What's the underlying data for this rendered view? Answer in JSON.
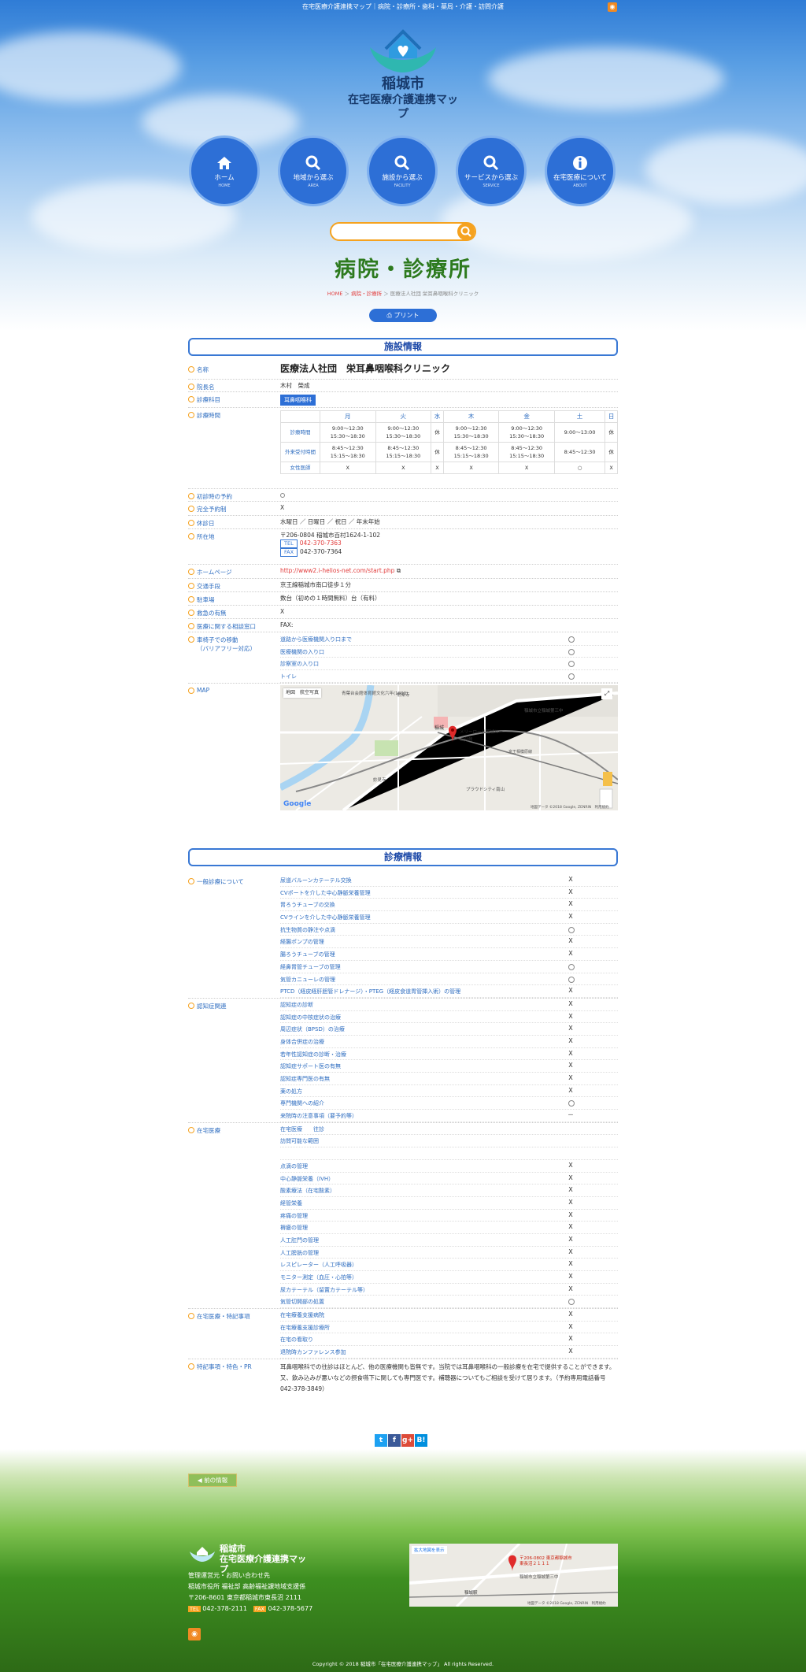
{
  "topbar": {
    "text": "在宅医療介護連携マップ｜病院・診療所・歯科・薬局・介護・訪問介護"
  },
  "logo": {
    "city": "稲城市",
    "sub": "在宅医療介護連携マップ"
  },
  "nav": [
    {
      "label": "ホーム",
      "en": "HOME",
      "icon": "home-icon"
    },
    {
      "label": "地域から選ぶ",
      "en": "AREA",
      "icon": "search-icon"
    },
    {
      "label": "施設から選ぶ",
      "en": "FACILITY",
      "icon": "search-icon"
    },
    {
      "label": "サービスから選ぶ",
      "en": "SERVICE",
      "icon": "search-icon"
    },
    {
      "label": "在宅医療について",
      "en": "ABOUT",
      "icon": "info-icon"
    }
  ],
  "page": {
    "title": "病院・診療所"
  },
  "breadcrumb": {
    "home": "HOME",
    "cat": "病院・診療所",
    "current": "医療法人社団 栄耳鼻咽喉科クリニック"
  },
  "print_label": "プリント",
  "facility": {
    "heading": "施設情報",
    "name_label": "名称",
    "name": "医療法人社団　栄耳鼻咽喉科クリニック",
    "director_label": "院長名",
    "director": "木村　榮成",
    "dept_label": "診療科目",
    "dept": "耳鼻咽喉科",
    "hours_label": "診療時間",
    "schedule": {
      "days": [
        "月",
        "火",
        "水",
        "木",
        "金",
        "土",
        "日"
      ],
      "rows": [
        {
          "label": "診療時間",
          "cells": [
            "9:00〜12:30\n15:30〜18:30",
            "9:00〜12:30\n15:30〜18:30",
            "休",
            "9:00〜12:30\n15:30〜18:30",
            "9:00〜12:30\n15:30〜18:30",
            "9:00〜13:00",
            "休"
          ]
        },
        {
          "label": "外来受付時間",
          "cells": [
            "8:45〜12:30\n15:15〜18:30",
            "8:45〜12:30\n15:15〜18:30",
            "休",
            "8:45〜12:30\n15:15〜18:30",
            "8:45〜12:30\n15:15〜18:30",
            "8:45〜12:30",
            "休"
          ]
        },
        {
          "label": "女性医師",
          "cells": [
            "X",
            "X",
            "X",
            "X",
            "X",
            "○",
            "X"
          ]
        }
      ]
    },
    "first_reserve_label": "初診時の予約",
    "full_reserve_label": "完全予約制",
    "full_reserve": "X",
    "holiday_label": "休診日",
    "holiday": "水曜日 ／ 日曜日 ／ 祝日 ／ 年末年始",
    "address_label": "所在地",
    "address": "〒206-0804 稲城市百村1624-1-102",
    "tel_tag": "TEL",
    "tel": "042-370-7363",
    "fax_tag": "FAX",
    "fax": "042-370-7364",
    "homepage_label": "ホームページ",
    "homepage": "http://www2.i-helios-net.com/start.php",
    "access_label": "交通手段",
    "access": "京王線稲城市南口徒歩１分",
    "parking_label": "駐車場",
    "parking": "数台（初めの１時間無料）台（有料）",
    "emergency_label": "救急の有無",
    "emergency": "X",
    "consult_label": "医療に関する相談窓口",
    "consult": "FAX:",
    "barrier_label": "車椅子での移動",
    "barrier_label2": "（バリアフリー対応）",
    "barrier": [
      "道路から医療機関入り口まで",
      "医療機関の入り口",
      "診察室の入り口",
      "トイレ"
    ],
    "map_label": "MAP",
    "map": {
      "tab1": "地図",
      "tab2": "航空写真",
      "station": "稲城",
      "clinic": "メリーロード稲城ルーム分館",
      "google": "Google",
      "terms": "地図データ ©2018 Google, ZENRIN　利用規約",
      "park": "青葉台会館体育館文化六年(1800)",
      "shrine": "妙見寺",
      "store": "プラウドシティ南山",
      "temple": "常楽寺",
      "cityhall": "稲城市立稲城第三中",
      "line": "京王相模原線"
    }
  },
  "medical": {
    "heading": "診療情報",
    "groups": [
      {
        "label": "一般診療について",
        "items": [
          [
            "尿道バルーンカテーテル交換",
            "X"
          ],
          [
            "CVポートを介した中心静脈栄養管理",
            "X"
          ],
          [
            "胃ろうチューブの交換",
            "X"
          ],
          [
            "CVラインを介した中心静脈栄養管理",
            "X"
          ],
          [
            "抗生物質の静注や点滴",
            "○"
          ],
          [
            "経腸ポンプの管理",
            "X"
          ],
          [
            "腸ろうチューブの管理",
            "X"
          ],
          [
            "経鼻胃管チューブの管理",
            "○"
          ],
          [
            "気管カニューレの管理",
            "○"
          ],
          [
            "PTCD（経皮経肝胆管ドレナージ）・PTEG（経皮食道胃管挿入術）の管理",
            "X"
          ]
        ]
      },
      {
        "label": "認知症関連",
        "items": [
          [
            "認知症の診断",
            "X"
          ],
          [
            "認知症の中核症状の治療",
            "X"
          ],
          [
            "周辺症状（BPSD）の治療",
            "X"
          ],
          [
            "身体合併症の治療",
            "X"
          ],
          [
            "若年性認知症の診断・治療",
            "X"
          ],
          [
            "認知症サポート医の有無",
            "X"
          ],
          [
            "認知症専門医の有無",
            "X"
          ],
          [
            "薬の処方",
            "X"
          ],
          [
            "専門機関への紹介",
            "○"
          ],
          [
            "来院時の注意事項（要予約等）",
            "－"
          ]
        ]
      },
      {
        "label": "在宅医療",
        "items": [
          [
            "在宅医療　　往診",
            ""
          ],
          [
            "訪問可能な範囲",
            ""
          ],
          [
            "",
            ""
          ],
          [
            "点滴の管理",
            "X"
          ],
          [
            "中心静脈栄養（IVH）",
            "X"
          ],
          [
            "酸素療法（在宅酸素）",
            "X"
          ],
          [
            "経管栄養",
            "X"
          ],
          [
            "疼痛の管理",
            "X"
          ],
          [
            "褥瘡の管理",
            "X"
          ],
          [
            "人工肛門の管理",
            "X"
          ],
          [
            "人工膀胱の管理",
            "X"
          ],
          [
            "レスピレーター（人工呼吸器）",
            "X"
          ],
          [
            "モニター測定（血圧・心拍等）",
            "X"
          ],
          [
            "尿カテーテル（留置カテーテル等）",
            "X"
          ],
          [
            "気管切開部の処置",
            "○"
          ]
        ]
      },
      {
        "label": "在宅医療・特記事項",
        "items": [
          [
            "在宅療養支援病院",
            "X"
          ],
          [
            "在宅療養支援診療所",
            "X"
          ],
          [
            "在宅の看取り",
            "X"
          ],
          [
            "退院時カンファレンス参加",
            "X"
          ]
        ]
      }
    ],
    "notes_label": "特記事項・特色・PR",
    "notes": "耳鼻咽喉科での往診はほとんど、他の医療機関も皆無です。当院では耳鼻咽喉科の一般診療を在宅で提供することができます。又、飲み込みが悪いなどの摂食嚥下に関しても専門医です。補聴器についてもご相談を受けて居ります。（予約専用電話番号042-378-3849）"
  },
  "share": [
    {
      "name": "twitter-icon",
      "label": "t",
      "color": "#1da1f2"
    },
    {
      "name": "facebook-icon",
      "label": "f",
      "color": "#3b5998"
    },
    {
      "name": "google-plus-icon",
      "label": "g+",
      "color": "#dd4b39"
    },
    {
      "name": "hatena-icon",
      "label": "B!",
      "color": "#008fde"
    }
  ],
  "back_label": "前の情報",
  "footer": {
    "logo_city": "稲城市",
    "logo_sub": "在宅医療介護連携マップ",
    "org": "管理運営元・お問い合わせ先",
    "dept": "稲城市役所 福祉部 高齢福祉課地域支援係",
    "addr": "〒206-8601 東京都稲城市東長沼 2111",
    "tel_tag": "TEL",
    "tel": "042-378-2111",
    "fax_tag": "FAX",
    "fax": "042-378-5677",
    "map_link": "拡大地図を表示",
    "map_addr": "〒206-0802 東京都稲城市東長沼２１１１",
    "map_place": "稲城市立稲城第三中",
    "map_station": "稲城駅",
    "map_terms": "地図データ ©2018 Google, ZENRIN　利用規約"
  },
  "copyright": "Copyright © 2018 稲城市「在宅医療介護連携マップ」 All rights Reserved."
}
